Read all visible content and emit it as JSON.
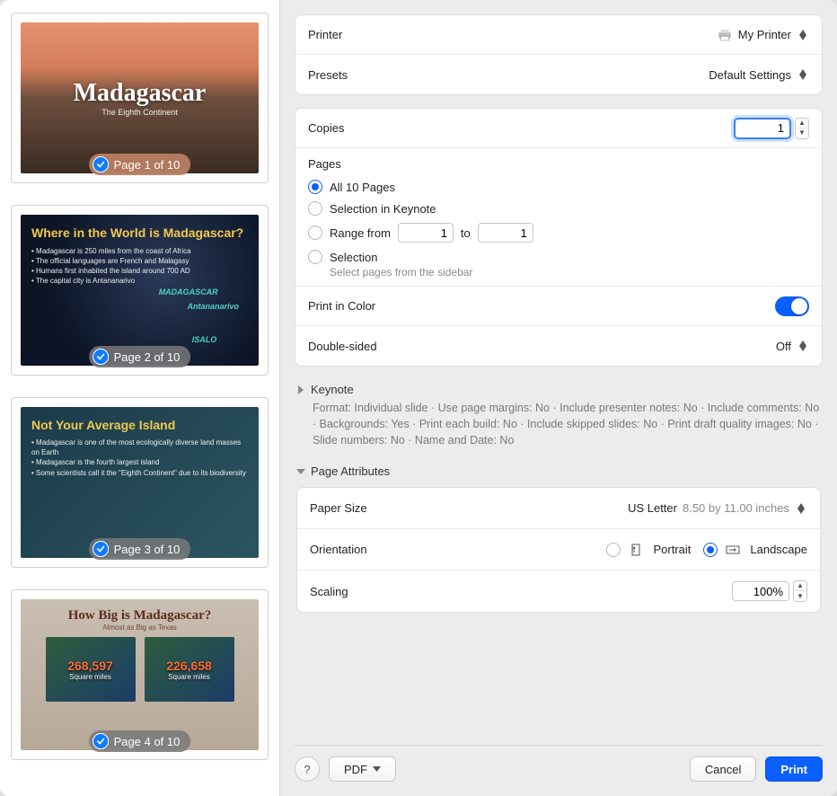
{
  "sidebar": {
    "thumbnails": [
      {
        "label": "Page 1 of 10",
        "title": "Madagascar",
        "subtitle": "The Eighth Continent",
        "checked": true
      },
      {
        "label": "Page 2 of 10",
        "title": "Where in the World is Madagascar?",
        "anno1": "MADAGASCAR",
        "anno2": "Antananarivo",
        "anno3": "ISALO",
        "checked": true
      },
      {
        "label": "Page 3 of 10",
        "title": "Not Your Average Island",
        "checked": true
      },
      {
        "label": "Page 4 of 10",
        "title": "How Big is Madagascar?",
        "subtitle": "Almost as Big as Texas",
        "val1": "268,597",
        "val2": "226,658",
        "unit": "Square miles",
        "checked": true
      }
    ]
  },
  "printer": {
    "label": "Printer",
    "value": "My Printer"
  },
  "presets": {
    "label": "Presets",
    "value": "Default Settings"
  },
  "copies": {
    "label": "Copies",
    "value": "1"
  },
  "pages": {
    "label": "Pages",
    "options": {
      "all": "All 10 Pages",
      "selection_app": "Selection in Keynote",
      "range_prefix": "Range from",
      "range_mid": "to",
      "range_from": "1",
      "range_to": "1",
      "selection": "Selection",
      "selection_hint": "Select pages from the sidebar"
    },
    "selected": "all"
  },
  "color": {
    "label": "Print in Color",
    "on": true
  },
  "duplex": {
    "label": "Double-sided",
    "value": "Off"
  },
  "keynote": {
    "title": "Keynote",
    "summary": "Format: Individual slide · Use page margins: No · Include presenter notes: No · Include comments: No · Backgrounds: Yes · Print each build: No · Include skipped slides: No · Print draft quality images: No · Slide numbers: No · Name and Date: No"
  },
  "page_attributes": {
    "title": "Page Attributes",
    "paper_size": {
      "label": "Paper Size",
      "value": "US Letter",
      "dim": "8.50 by 11.00 inches"
    },
    "orientation": {
      "label": "Orientation",
      "portrait": "Portrait",
      "landscape": "Landscape",
      "selected": "landscape"
    },
    "scaling": {
      "label": "Scaling",
      "value": "100%"
    }
  },
  "footer": {
    "help": "?",
    "pdf": "PDF",
    "cancel": "Cancel",
    "print": "Print"
  }
}
